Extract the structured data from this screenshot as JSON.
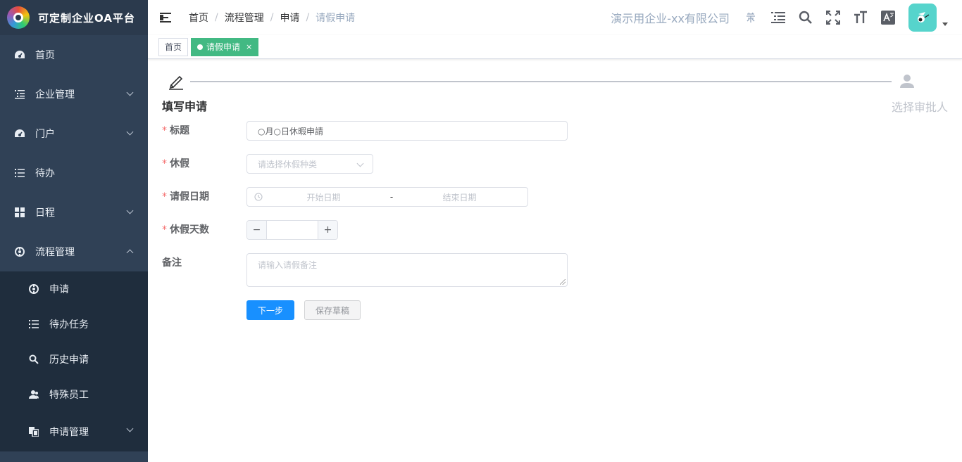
{
  "brand": {
    "title": "可定制企业OA平台"
  },
  "sidebar": {
    "items": [
      {
        "label": "首页",
        "icon": "dashboard-icon"
      },
      {
        "label": "企业管理",
        "icon": "tree-list-icon"
      },
      {
        "label": "门户",
        "icon": "dashboard-icon"
      },
      {
        "label": "待办",
        "icon": "list-icon"
      },
      {
        "label": "日程",
        "icon": "grid-icon"
      },
      {
        "label": "流程管理",
        "icon": "flow-icon"
      }
    ],
    "subitems": [
      {
        "label": "申请",
        "icon": "flow-icon"
      },
      {
        "label": "待办任务",
        "icon": "list-icon"
      },
      {
        "label": "历史申请",
        "icon": "search-icon"
      },
      {
        "label": "特殊员工",
        "icon": "user-group-icon"
      },
      {
        "label": "申请管理",
        "icon": "copy-icon"
      }
    ]
  },
  "header": {
    "breadcrumbs": [
      "首页",
      "流程管理",
      "申请",
      "请假申请"
    ],
    "company": "演示用企业-xx有限公司"
  },
  "tags": [
    {
      "label": "首页"
    },
    {
      "label": "请假申请",
      "close": "×"
    }
  ],
  "steps": [
    {
      "title": "填写申请"
    },
    {
      "title": "选择审批人"
    }
  ],
  "form": {
    "title_label": "标题",
    "title_value": "○月○日休暇申請",
    "leave_label": "休假",
    "leave_placeholder": "请选择休假种类",
    "date_label": "请假日期",
    "date_start_placeholder": "开始日期",
    "date_sep": "-",
    "date_end_placeholder": "结束日期",
    "days_label": "休假天数",
    "days_minus": "−",
    "days_plus": "+",
    "note_label": "备注",
    "note_placeholder": "请输入请假备注",
    "required_mark": "*"
  },
  "buttons": {
    "next": "下一步",
    "save_draft": "保存草稿"
  },
  "colors": {
    "sidebar": "#304156",
    "submenu": "#1f2d3d",
    "primary": "#1890ff",
    "tag_active": "#42b983",
    "avatar": "#56d4cc"
  }
}
